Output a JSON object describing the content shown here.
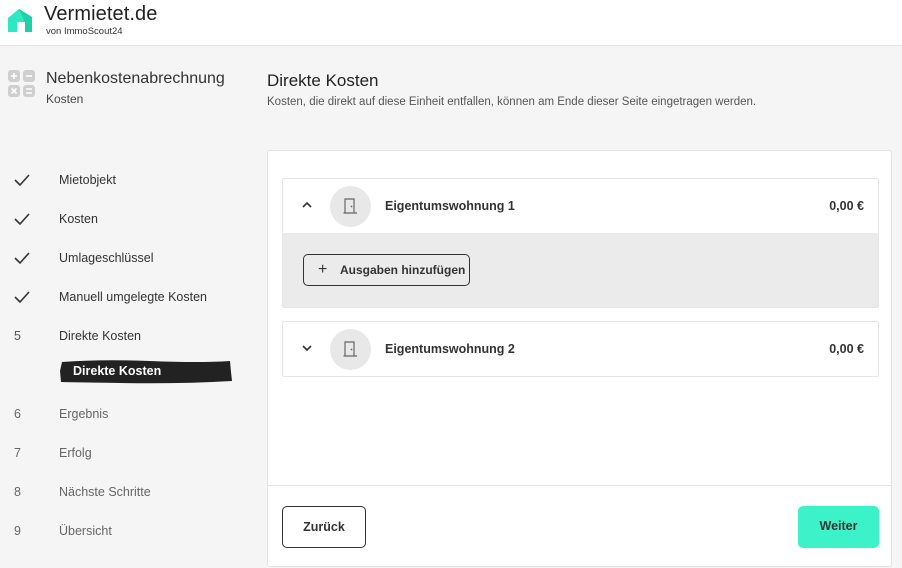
{
  "header": {
    "brand": "Vermietet.de",
    "brand_sub": "von ImmoScout24",
    "logo_icon": "house-logo-icon"
  },
  "sidebar": {
    "icon": "calculator-icon",
    "title": "Nebenkostenabrechnung",
    "subtitle": "Kosten",
    "steps": [
      {
        "mark": "",
        "status": "done",
        "label": "Mietobjekt"
      },
      {
        "mark": "",
        "status": "done",
        "label": "Kosten"
      },
      {
        "mark": "",
        "status": "done",
        "label": "Umlageschlüssel"
      },
      {
        "mark": "",
        "status": "done",
        "label": "Manuell umgelegte Kosten"
      },
      {
        "mark": "5",
        "status": "current",
        "label": "Direkte Kosten"
      },
      {
        "mark": "6",
        "status": "pending",
        "label": "Ergebnis"
      },
      {
        "mark": "7",
        "status": "pending",
        "label": "Erfolg"
      },
      {
        "mark": "8",
        "status": "pending",
        "label": "Nächste Schritte"
      },
      {
        "mark": "9",
        "status": "pending",
        "label": "Übersicht"
      }
    ],
    "active_substep": "Direkte Kosten"
  },
  "main": {
    "title": "Direkte Kosten",
    "description": "Kosten, die direkt auf diese Einheit entfallen, können am Ende dieser Seite eingetragen werden.",
    "units": [
      {
        "name": "Eigentumswohnung 1",
        "amount": "0,00 €",
        "expanded": true,
        "add_label": "Ausgaben hinzufügen"
      },
      {
        "name": "Eigentumswohnung 2",
        "amount": "0,00 €",
        "expanded": false
      }
    ],
    "back_label": "Zurück",
    "next_label": "Weiter"
  },
  "colors": {
    "accent": "#3cf2c9",
    "logo": "#2ee8c2",
    "active_bg": "#222222"
  }
}
